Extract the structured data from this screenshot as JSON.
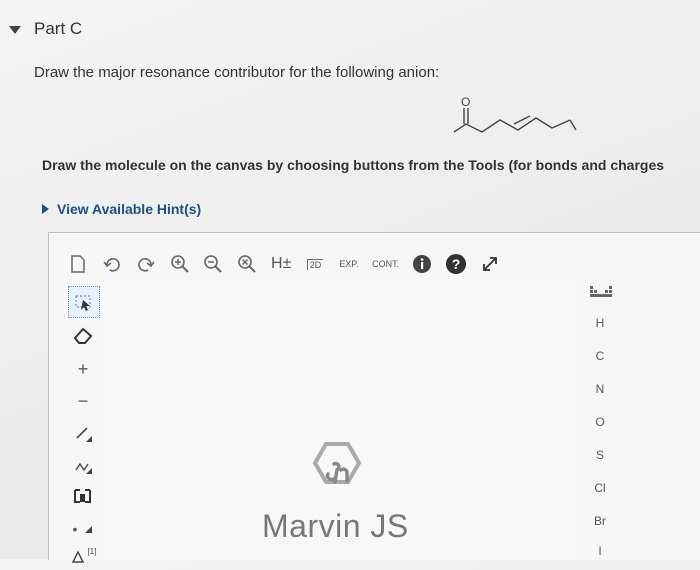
{
  "part": {
    "title": "Part C"
  },
  "question": "Draw the major resonance contributor for the following anion:",
  "instructions": "Draw the molecule on the canvas by choosing buttons from the Tools (for bonds and charges",
  "hints": {
    "label": "View Available Hint(s)"
  },
  "molecule": {
    "atom_label": "O"
  },
  "toolbar": {
    "h_label": "H±",
    "twod_label": "2D",
    "exp_label": "EXP.",
    "cont_label": "CONT.",
    "icons": [
      "document-icon",
      "undo-icon",
      "redo-icon",
      "zoom-in-icon",
      "zoom-out-icon",
      "zoom-reset-icon",
      "explicit-h-icon",
      "2d-clean-icon",
      "expand-icon",
      "contract-icon",
      "info-icon",
      "help-icon",
      "fullscreen-icon"
    ]
  },
  "left_tools": {
    "plus_label": "+",
    "minus_label": "−",
    "dot_label": "•",
    "ring_label": "[1]",
    "icons": [
      "selection-tool-icon",
      "eraser-icon",
      "charge-plus-icon",
      "charge-minus-icon",
      "single-bond-icon",
      "chain-icon",
      "template-icon",
      "radical-icon",
      "ring-icon"
    ]
  },
  "atoms": [
    "H",
    "C",
    "N",
    "O",
    "S",
    "Cl",
    "Br",
    "I"
  ],
  "watermark": "Marvin JS",
  "colors": {
    "link": "#1e4f86",
    "text": "#333333",
    "icon": "#555555"
  }
}
